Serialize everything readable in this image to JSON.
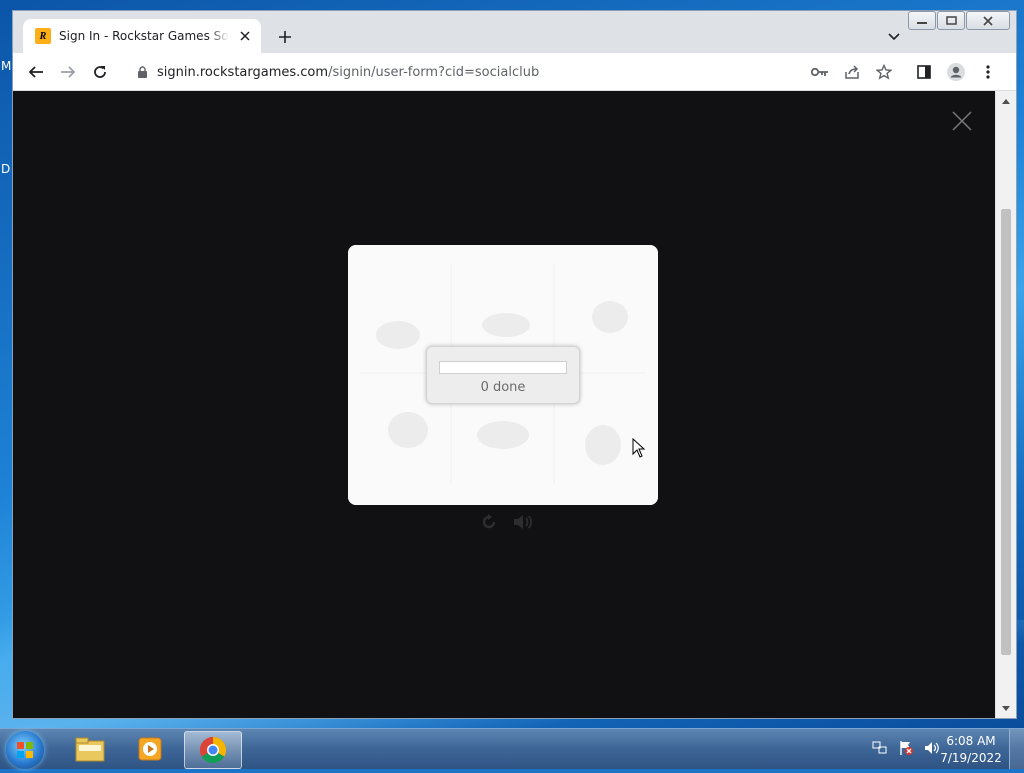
{
  "desktop": {
    "left_labels": [
      "M",
      "D"
    ]
  },
  "browser": {
    "tab": {
      "title": "Sign In - Rockstar Games Social Club",
      "favicon_letter": "R"
    },
    "address": {
      "host": "signin.rockstargames.com",
      "path": "/signin/user-form?cid=socialclub"
    }
  },
  "captcha": {
    "progress_text": "0 done",
    "progress_fraction": 0
  },
  "taskbar": {
    "clock_time": "6:08 AM",
    "clock_date": "7/19/2022"
  },
  "colors": {
    "page_background": "#111113",
    "favicon": "#fcaf17"
  }
}
